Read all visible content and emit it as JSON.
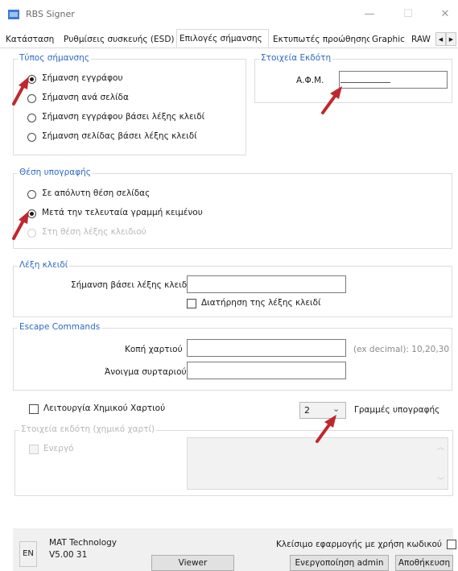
{
  "window": {
    "title": "RBS Signer",
    "minimize_glyph": "—",
    "maximize_glyph": "☐",
    "close_glyph": "✕"
  },
  "tabs": [
    {
      "label": "Κατάσταση"
    },
    {
      "label": "Ρυθμίσεις συσκευής (ESD)"
    },
    {
      "label": "Επιλογές σήμανσης"
    },
    {
      "label": "Εκτυπωτές προώθησης"
    },
    {
      "label": "Graphic"
    },
    {
      "label": "RAW"
    }
  ],
  "tab_scroll": {
    "left_glyph": "◀",
    "right_glyph": "▶"
  },
  "marking_type": {
    "legend": "Τύπος σήμανσης",
    "options": [
      {
        "label": "Σήμανση εγγράφου",
        "checked": true
      },
      {
        "label": "Σήμανση ανά σελίδα",
        "checked": false
      },
      {
        "label": "Σήμανση εγγράφου βάσει λέξης κλειδί",
        "checked": false
      },
      {
        "label": "Σήμανση σελίδας βάσει λέξης κλειδί",
        "checked": false
      }
    ]
  },
  "issuer": {
    "legend": "Στοιχεία Εκδότη",
    "afm_label": "Α.Φ.Μ.",
    "afm_value": ""
  },
  "signature_position": {
    "legend": "Θέση υπογραφής",
    "options": [
      {
        "label": "Σε απόλυτη θέση σελίδας",
        "checked": false,
        "disabled": false
      },
      {
        "label": "Μετά την τελευταία γραμμή κειμένου",
        "checked": true,
        "disabled": false
      },
      {
        "label": "Στη θέση λέξης κλειδιού",
        "checked": false,
        "disabled": true
      }
    ]
  },
  "keyword": {
    "legend": "Λέξη κλειδί",
    "field_label": "Σήμανση βάσει λέξης κλειδί",
    "field_value": "",
    "keep_label": "Διατήρηση της λέξης κλειδί"
  },
  "escape": {
    "legend": "Escape Commands",
    "cut_label": "Κοπή χαρτιού",
    "cut_value": "",
    "drawer_label": "Άνοιγμα συρταριού",
    "drawer_value": "",
    "hint": "(ex decimal): 10,20,30"
  },
  "thermal": {
    "checkbox_label": "Λειτουργία Χημικού Χαρτιού",
    "lines_value": "2",
    "lines_label": "Γραμμές υπογραφής",
    "legend": "Στοιχεία εκδότη (χημικό χαρτί)",
    "active_label": "Ενεργό"
  },
  "footer": {
    "lang": "EN",
    "company": "MAT Technology",
    "version": "V5.00 31",
    "viewer_label": "Viewer",
    "close_pw_label": "Κλείσιμο εφαρμογής με χρήση κωδικού",
    "admin_label": "Ενεργοποίηση admin",
    "save_label": "Αποθήκευση"
  },
  "colors": {
    "legend": "#2d68c4",
    "annotation_arrow": "#c0272d"
  }
}
